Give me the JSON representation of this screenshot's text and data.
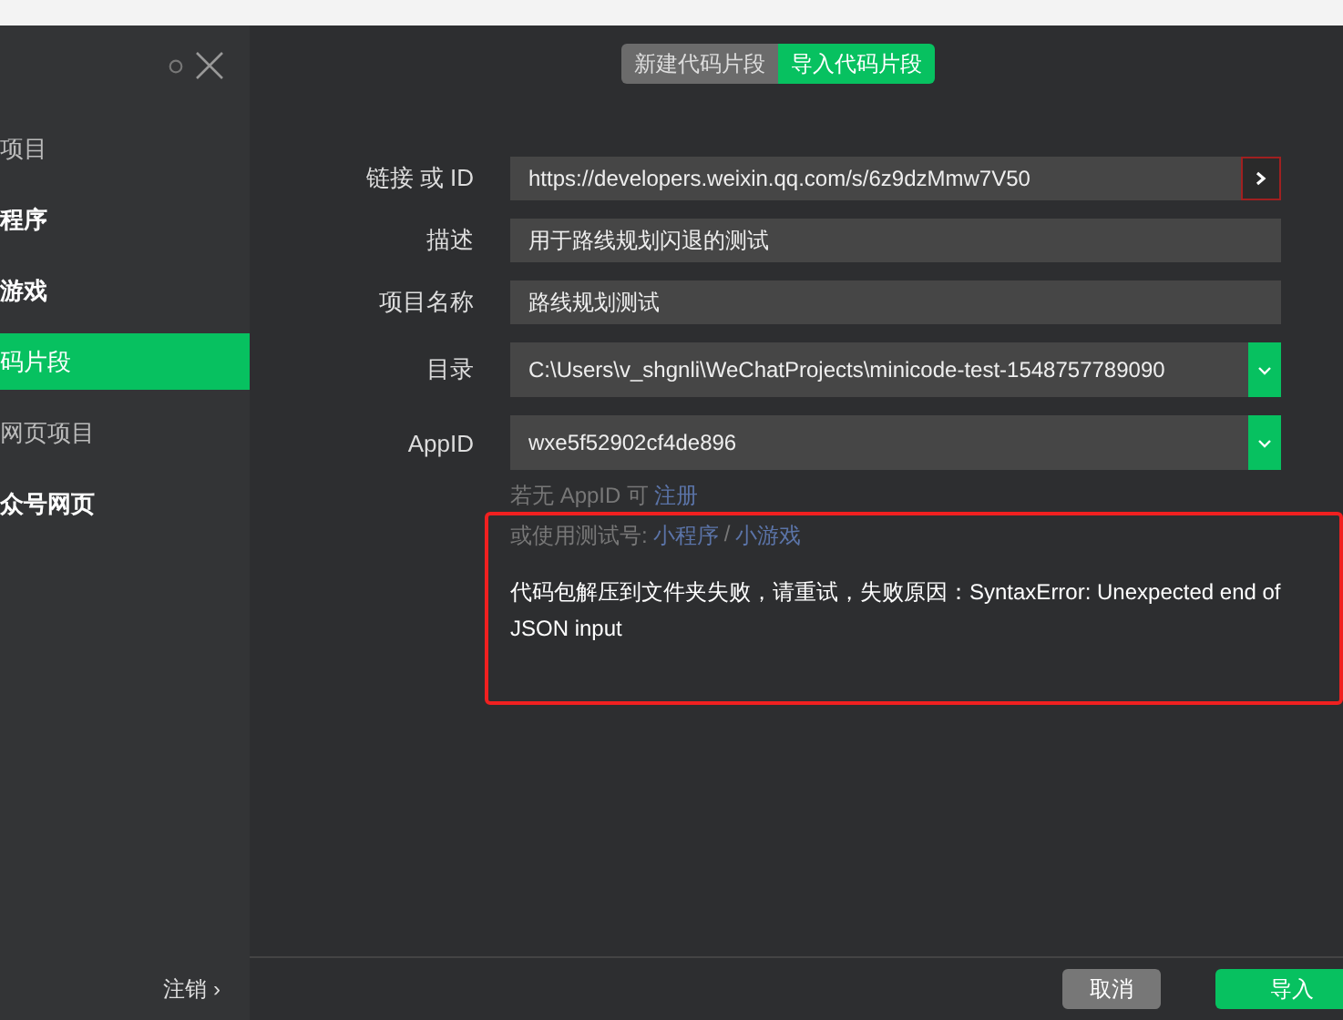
{
  "sidebar": {
    "items": [
      {
        "label": "项目",
        "selected": false,
        "bright": false
      },
      {
        "label": "程序",
        "selected": false,
        "bright": true
      },
      {
        "label": "游戏",
        "selected": false,
        "bright": true
      },
      {
        "label": "码片段",
        "selected": true,
        "bright": true
      },
      {
        "label": "网页项目",
        "selected": false,
        "bright": false
      },
      {
        "label": "众号网页",
        "selected": false,
        "bright": true
      }
    ],
    "logout": "注销 ›"
  },
  "tabs": [
    {
      "label": "新建代码片段",
      "selected": false
    },
    {
      "label": "导入代码片段",
      "selected": true
    }
  ],
  "form": [
    {
      "kind": "link",
      "label": "链接 或 ID",
      "value": "https://developers.weixin.qq.com/s/6z9dzMmw7V50"
    },
    {
      "kind": "text",
      "label": "描述",
      "value": "用于路线规划闪退的测试"
    },
    {
      "kind": "text",
      "label": "项目名称",
      "value": "路线规划测试"
    },
    {
      "kind": "select",
      "label": "目录",
      "value": "C:\\Users\\v_shgnli\\WeChatProjects\\minicode-test-1548757789090"
    },
    {
      "kind": "select",
      "label": "AppID",
      "value": "wxe5f52902cf4de896"
    }
  ],
  "hint": {
    "line1": "若无 AppID 可",
    "register": "注册",
    "line2": "或使用测试号:",
    "mini_program": "小程序",
    "separator": "/",
    "mini_game": "小游戏"
  },
  "error": "代码包解压到文件夹失败，请重试，失败原因：SyntaxError: Unexpected end of JSON input",
  "buttons": {
    "cancel": "取消",
    "import": "导入"
  }
}
